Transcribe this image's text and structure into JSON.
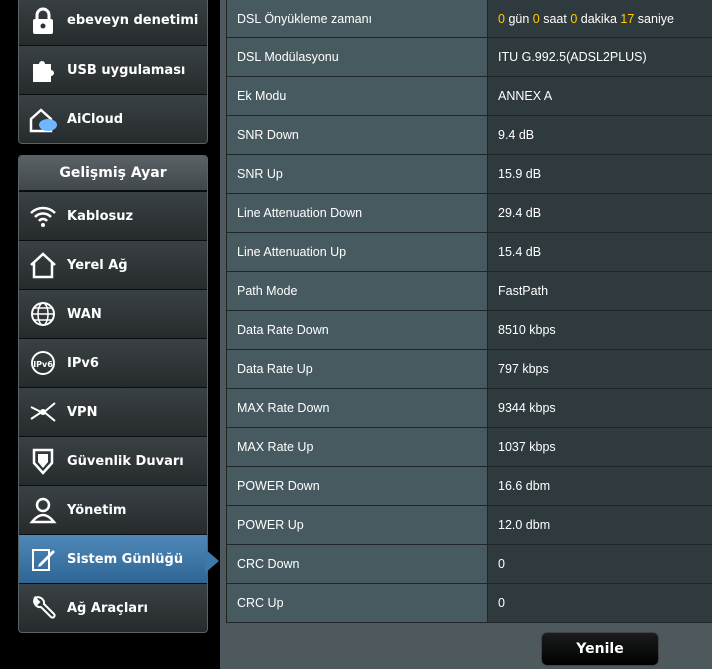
{
  "sidebar": {
    "top_group": [
      {
        "label": "ebeveyn denetimi",
        "icon": "lock-icon"
      },
      {
        "label": "USB uygulaması",
        "icon": "puzzle-icon"
      },
      {
        "label": "AiCloud",
        "icon": "cloud-house-icon"
      }
    ],
    "advanced_header": "Gelişmiş Ayar",
    "advanced_items": [
      {
        "label": "Kablosuz",
        "icon": "wifi-icon"
      },
      {
        "label": "Yerel Ağ",
        "icon": "home-icon"
      },
      {
        "label": "WAN",
        "icon": "globe-icon"
      },
      {
        "label": "IPv6",
        "icon": "ipv6-globe-icon"
      },
      {
        "label": "VPN",
        "icon": "vpn-icon"
      },
      {
        "label": "Güvenlik Duvarı",
        "icon": "shield-icon"
      },
      {
        "label": "Yönetim",
        "icon": "user-icon"
      },
      {
        "label": "Sistem Günlüğü",
        "icon": "log-edit-icon"
      },
      {
        "label": "Ağ Araçları",
        "icon": "tools-icon"
      }
    ],
    "active_item": "Sistem Günlüğü"
  },
  "status_table": {
    "uptime": {
      "label": "DSL Önyükleme zamanı",
      "days": "0",
      "days_unit": "gün",
      "hours": "0",
      "hours_unit": "saat",
      "minutes": "0",
      "minutes_unit": "dakika",
      "seconds": "17",
      "seconds_unit": "saniye"
    },
    "rows": [
      {
        "label": "DSL Modülasyonu",
        "value": "ITU G.992.5(ADSL2PLUS)"
      },
      {
        "label": "Ek Modu",
        "value": "ANNEX A"
      },
      {
        "label": "SNR Down",
        "value": "9.4 dB"
      },
      {
        "label": "SNR Up",
        "value": "15.9 dB"
      },
      {
        "label": "Line Attenuation Down",
        "value": "29.4 dB"
      },
      {
        "label": "Line Attenuation Up",
        "value": "15.4 dB"
      },
      {
        "label": "Path Mode",
        "value": "FastPath"
      },
      {
        "label": "Data Rate Down",
        "value": "8510 kbps"
      },
      {
        "label": "Data Rate Up",
        "value": "797 kbps"
      },
      {
        "label": "MAX Rate Down",
        "value": "9344 kbps"
      },
      {
        "label": "MAX Rate Up",
        "value": "1037 kbps"
      },
      {
        "label": "POWER Down",
        "value": "16.6 dbm"
      },
      {
        "label": "POWER Up",
        "value": "12.0 dbm"
      },
      {
        "label": "CRC Down",
        "value": "0"
      },
      {
        "label": "CRC Up",
        "value": "0"
      }
    ]
  },
  "refresh_button": "Yenile",
  "colors": {
    "highlight": "#ffcc00",
    "active_nav": "#3f79aa",
    "panel_bg": "#4d595d"
  }
}
